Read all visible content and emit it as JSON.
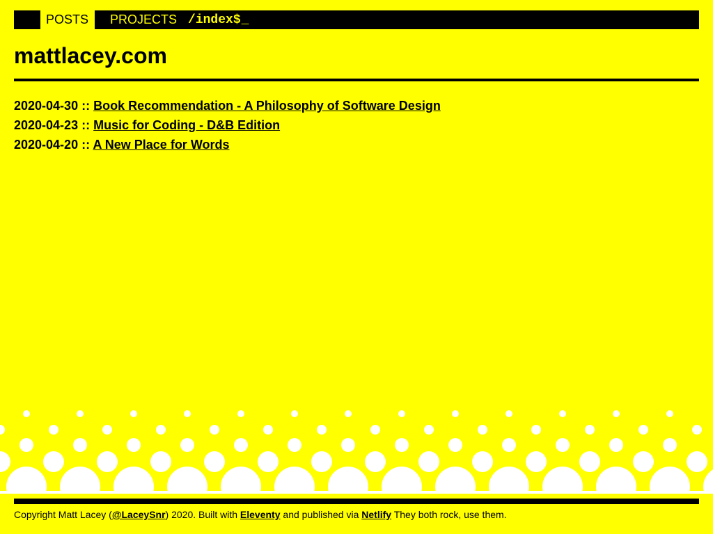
{
  "nav": {
    "posts_label": "POSTS",
    "projects_label": "PROJECTS",
    "path": "/index$",
    "cursor": "_"
  },
  "site": {
    "title": "mattlacey.com"
  },
  "posts": [
    {
      "date": "2020-04-30",
      "sep": "::",
      "title": "Book Recommendation - A Philosophy of Software Design"
    },
    {
      "date": "2020-04-23",
      "sep": "::",
      "title": "Music for Coding - D&B Edition"
    },
    {
      "date": "2020-04-20",
      "sep": "::",
      "title": "A New Place for Words"
    }
  ],
  "footer": {
    "prefix": "Copyright Matt Lacey (",
    "handle": "@LaceySnr",
    "mid1": ") 2020. Built with ",
    "eleventy": "Eleventy",
    "mid2": " and published via ",
    "netlify": "Netlify",
    "suffix": " They both rock, use them."
  },
  "colors": {
    "background": "#ffff00",
    "foreground": "#000000",
    "dots": "#ffffff"
  }
}
